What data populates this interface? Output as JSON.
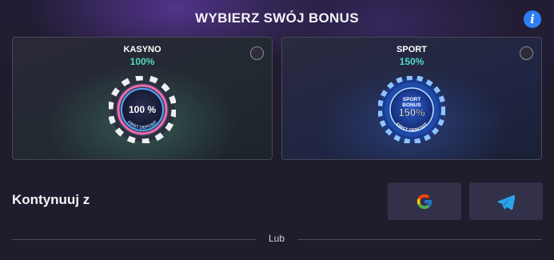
{
  "header": {
    "title": "WYBIERZ SWÓJ BONUS",
    "info_icon": "info-icon"
  },
  "bonuses": [
    {
      "name": "KASYNO",
      "percent": "100%",
      "chip_text": "100 %",
      "chip_arc": "FIRST DEPOSIT",
      "selected": false,
      "accent": "#54d6c2"
    },
    {
      "name": "SPORT",
      "percent": "150%",
      "chip_top": "SPORT",
      "chip_mid": "BONUS",
      "chip_text": "150%",
      "chip_arc": "FIRST DEPOSIT",
      "selected": false,
      "accent": "#54d6c2"
    }
  ],
  "continue": {
    "label": "Kontynuuj z",
    "providers": [
      {
        "name": "Google",
        "icon": "google-icon"
      },
      {
        "name": "Telegram",
        "icon": "telegram-icon"
      }
    ]
  },
  "divider": {
    "text": "Lub"
  },
  "colors": {
    "background": "#1f1c2b",
    "button": "#33304a",
    "info": "#2f7df2",
    "telegram": "#2aa3e8"
  }
}
